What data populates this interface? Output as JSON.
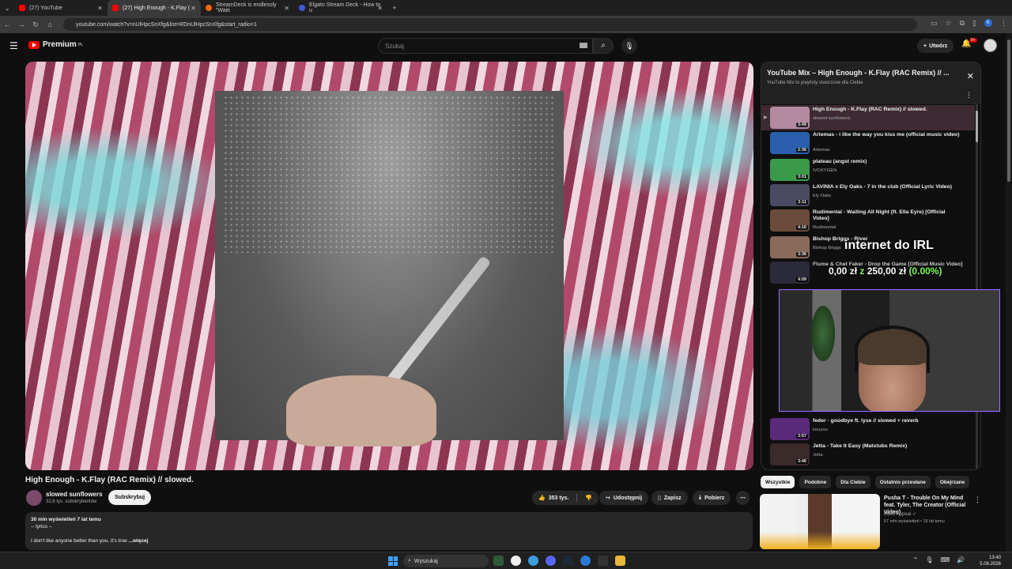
{
  "browser": {
    "tabs": [
      {
        "label": "(27) YouTube",
        "color": "#ff0000"
      },
      {
        "label": "(27) High Enough - K.Flay (",
        "color": "#ff0000"
      },
      {
        "label": "StreamDeck is endlessly \"Waiti",
        "color": "#ff6a00"
      },
      {
        "label": "Elgato Stream Deck - How to u",
        "color": "#3b5bdb"
      }
    ],
    "url": "youtube.com/watch?v=nUlHpcSnXfg&list=RDnUlHpcSnXfg&start_radio=1"
  },
  "yt": {
    "logo": "Premium",
    "region": "PL",
    "search_placeholder": "Szukaj",
    "create": "Utwórz",
    "notif_count": "9+"
  },
  "video": {
    "title": "High Enough - K.Flay (RAC Remix) // slowed.",
    "channel": "slowed sunflowers",
    "subs": "32,6 tys. subskrybentów",
    "subscribe": "Subskrybuj",
    "likes": "353 tys.",
    "share": "Udostępnij",
    "save": "Zapisz",
    "download": "Pobierz",
    "stats": "30 mln wyświetleń  7 lat temu",
    "desc_line1": "-- lyrics --",
    "desc_line2": "I don't like anyone better than you, it's true",
    "more": "...więcej"
  },
  "mix": {
    "title": "YouTube Mix – High Enough - K.Flay (RAC Remix) // ...",
    "subtitle": "YouTube Mix to playlisty stworzone dla Ciebie",
    "items": [
      {
        "title": "High Enough - K.Flay (RAC Remix) // slowed.",
        "channel": "slowed sunflowers",
        "dur": "3:49",
        "color": "#b48aa0"
      },
      {
        "title": "Artemas - i like the way you kiss me (official music video)",
        "channel": "Artemas",
        "dur": "2:36",
        "color": "#2b5fae"
      },
      {
        "title": "plateau (angst remix)",
        "channel": "IVOXYGEN",
        "dur": "3:01",
        "color": "#3a9a4a"
      },
      {
        "title": "LAVINIA x Ely Oaks - 7 in the club (Official Lyric Video)",
        "channel": "Ely Oaks",
        "dur": "2:11",
        "color": "#4a4a60"
      },
      {
        "title": "Rudimental - Waiting All Night (ft. Ella Eyre) [Official Video]",
        "channel": "Rudimental",
        "dur": "4:16",
        "color": "#6a4a3a"
      },
      {
        "title": "Bishop Briggs - River",
        "channel": "Bishop Briggs",
        "dur": "3:36",
        "color": "#8a6a5a"
      },
      {
        "title": "Flume & Chet Faker - Drop the Game [Official Music Video]",
        "channel": "",
        "dur": "4:09",
        "color": "#2a2a3a"
      },
      {
        "title": "feder - goodbye ft. lyse // slowed + reverb",
        "channel": "kouyou",
        "dur": "3:57",
        "color": "#5a2a7a"
      },
      {
        "title": "Jetta - Take It Easy (Matstubs Remix)",
        "channel": "Jetta",
        "dur": "3:40",
        "color": "#3a2a2a"
      }
    ]
  },
  "overlay": {
    "headline": "internet do IRL",
    "current": "0,00 zł",
    "of": "z",
    "goal": "250,00 zł",
    "pct": "(0.00%)"
  },
  "chips": [
    "Wszystkie",
    "Podobne",
    "Dla Ciebie",
    "Ostatnio przesłane",
    "Obejrzane"
  ],
  "rec": {
    "title": "Pusha T - Trouble On My Mind feat. Tyler, The Creator (Official Video)",
    "channel": "Mass Appeal",
    "meta": "57 mln wyświetleń • 15 lat temu"
  },
  "taskbar": {
    "search": "Wyszukaj",
    "time": "13:40",
    "date": "5.08.2026"
  }
}
